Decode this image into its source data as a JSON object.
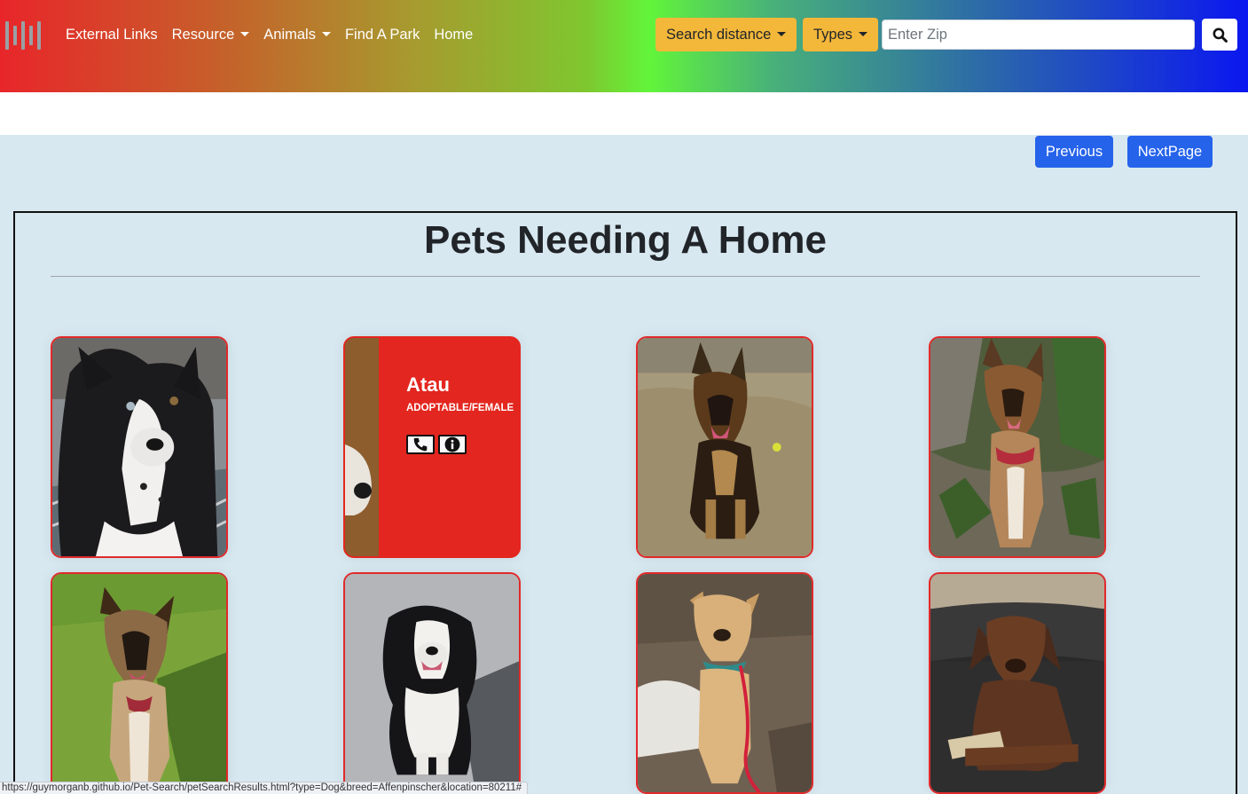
{
  "nav": {
    "links": [
      {
        "label": "External Links",
        "dropdown": false
      },
      {
        "label": "Resource",
        "dropdown": true
      },
      {
        "label": "Animals",
        "dropdown": true
      },
      {
        "label": "Find A Park",
        "dropdown": false
      },
      {
        "label": "Home",
        "dropdown": false
      }
    ],
    "search_distance_label": "Search distance",
    "types_label": "Types",
    "zip_placeholder": "Enter Zip",
    "search_icon": "search-icon"
  },
  "pagination": {
    "previous_label": "Previous",
    "next_label": "NextPage"
  },
  "main": {
    "title": "Pets Needing A Home"
  },
  "pets": [
    {
      "image": "black-white-border-collie-photo"
    },
    {
      "name": "Atau",
      "status": "ADOPTABLE/FEMALE",
      "icons": [
        "phone-icon",
        "info-icon"
      ]
    },
    {
      "image": "german-shepherd-sitting-on-grass-photo"
    },
    {
      "image": "shepherd-mix-in-garden-photo"
    },
    {
      "image": "shepherd-mix-on-lawn-photo"
    },
    {
      "image": "border-collie-on-pavement-photo"
    },
    {
      "image": "tan-dog-with-red-leash-photo"
    },
    {
      "image": "brown-dog-on-leather-couch-photo"
    }
  ],
  "status_bar": {
    "url": "https://guymorganb.github.io/Pet-Search/petSearchResults.html?type=Dog&breed=Affenpinscher&location=80211#"
  },
  "colors": {
    "accent_warning": "#f3b73a",
    "primary_button": "#2563eb",
    "card_border": "#e1292a",
    "page_background": "#d8e8f0"
  }
}
